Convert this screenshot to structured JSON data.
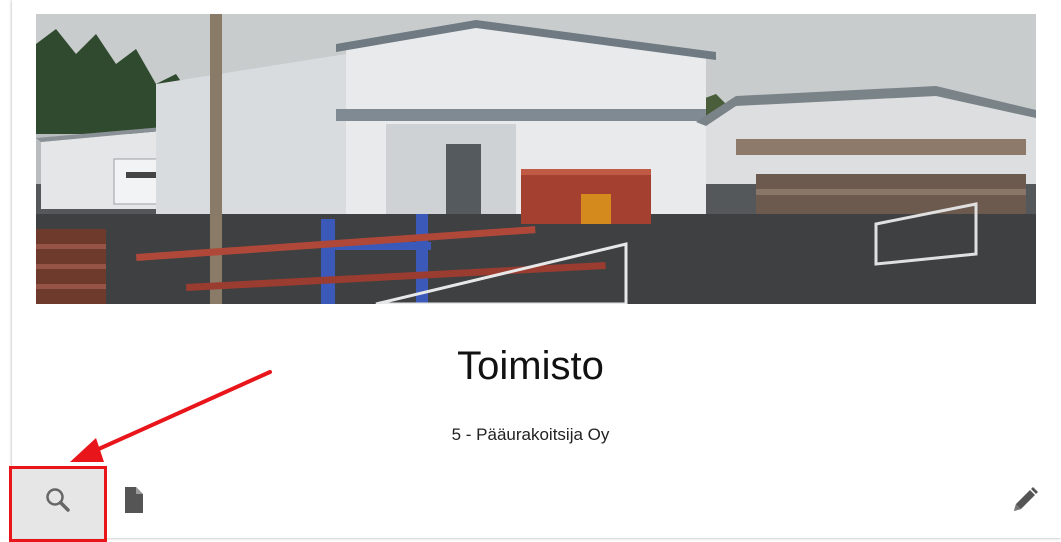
{
  "card": {
    "title": "Toimisto",
    "subtitle": "5 - Pääurakoitsija Oy"
  },
  "toolbar": {
    "icons": [
      "search-icon",
      "document-icon",
      "pencil-icon"
    ]
  },
  "colors": {
    "highlight": "#e8151b",
    "search_button_bg": "#e6e6e6",
    "icon": "#555555"
  }
}
